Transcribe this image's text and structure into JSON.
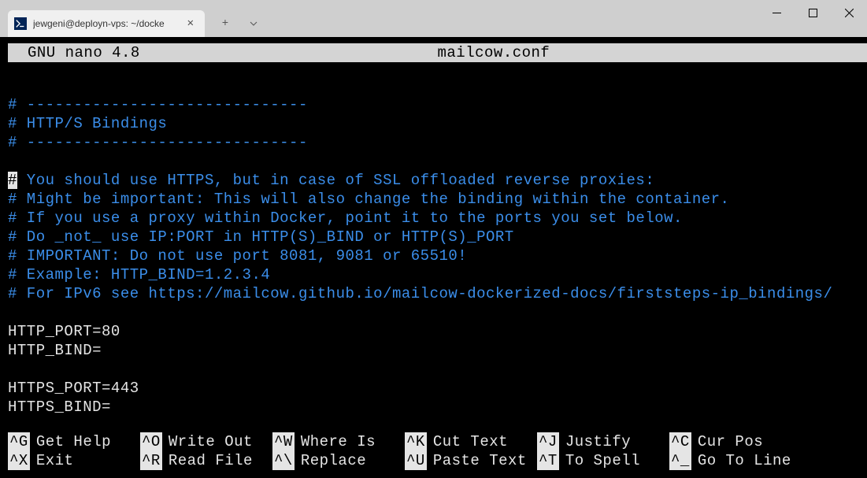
{
  "window": {
    "tab_title": "jewgeni@deployn-vps: ~/docke"
  },
  "nano": {
    "app_name": "  GNU nano 4.8",
    "filename": "mailcow.conf"
  },
  "editor_lines": [
    {
      "type": "blank",
      "text": ""
    },
    {
      "type": "comment",
      "text": "# ------------------------------"
    },
    {
      "type": "comment",
      "text": "# HTTP/S Bindings"
    },
    {
      "type": "comment",
      "text": "# ------------------------------"
    },
    {
      "type": "blank",
      "text": ""
    },
    {
      "type": "comment_cursor",
      "cursor": "#",
      "rest": " You should use HTTPS, but in case of SSL offloaded reverse proxies:"
    },
    {
      "type": "comment",
      "text": "# Might be important: This will also change the binding within the container."
    },
    {
      "type": "comment",
      "text": "# If you use a proxy within Docker, point it to the ports you set below."
    },
    {
      "type": "comment",
      "text": "# Do _not_ use IP:PORT in HTTP(S)_BIND or HTTP(S)_PORT"
    },
    {
      "type": "comment",
      "text": "# IMPORTANT: Do not use port 8081, 9081 or 65510!"
    },
    {
      "type": "comment",
      "text": "# Example: HTTP_BIND=1.2.3.4"
    },
    {
      "type": "comment",
      "text": "# For IPv6 see https://mailcow.github.io/mailcow-dockerized-docs/firststeps-ip_bindings/"
    },
    {
      "type": "blank",
      "text": ""
    },
    {
      "type": "plain",
      "text": "HTTP_PORT=80"
    },
    {
      "type": "plain",
      "text": "HTTP_BIND="
    },
    {
      "type": "blank",
      "text": ""
    },
    {
      "type": "plain",
      "text": "HTTPS_PORT=443"
    },
    {
      "type": "plain",
      "text": "HTTPS_BIND="
    }
  ],
  "shortcuts_row1": [
    {
      "key": "^G",
      "label": "Get Help"
    },
    {
      "key": "^O",
      "label": "Write Out"
    },
    {
      "key": "^W",
      "label": "Where Is"
    },
    {
      "key": "^K",
      "label": "Cut Text"
    },
    {
      "key": "^J",
      "label": "Justify"
    },
    {
      "key": "^C",
      "label": "Cur Pos"
    }
  ],
  "shortcuts_row2": [
    {
      "key": "^X",
      "label": "Exit"
    },
    {
      "key": "^R",
      "label": "Read File"
    },
    {
      "key": "^\\",
      "label": "Replace"
    },
    {
      "key": "^U",
      "label": "Paste Text"
    },
    {
      "key": "^T",
      "label": "To Spell"
    },
    {
      "key": "^_",
      "label": "Go To Line"
    }
  ]
}
